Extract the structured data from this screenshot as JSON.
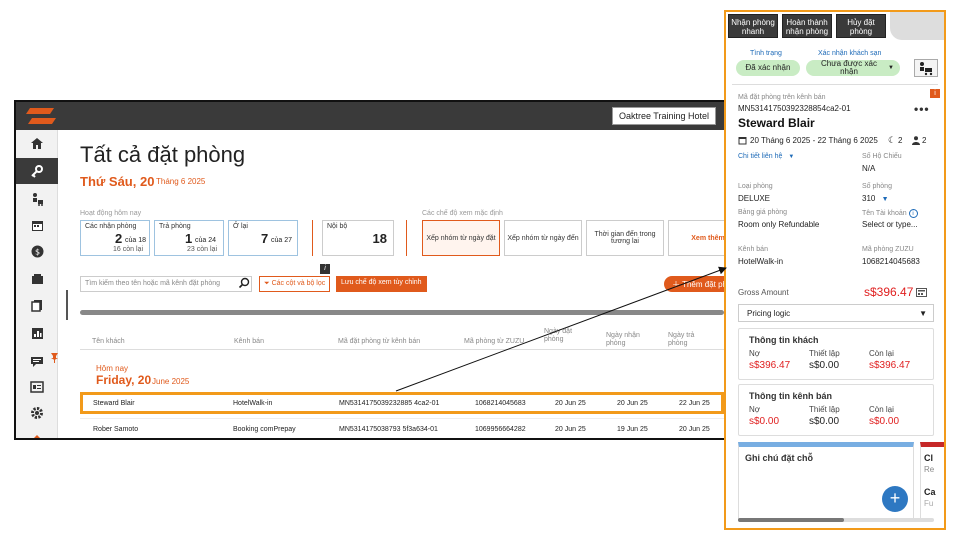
{
  "topbar": {
    "hotel_name": "Oaktree Training Hotel"
  },
  "page": {
    "title": "Tất cả đặt phòng",
    "day": "Thứ Sáu, 20",
    "month": "Tháng 6 2025"
  },
  "activity": {
    "label": "Hoạt động hôm nay",
    "cards": [
      {
        "label": "Các nhận phòng",
        "value": "2",
        "of": "của 18",
        "sub": "16 còn lại"
      },
      {
        "label": "Trả phòng",
        "value": "1",
        "of": "của 24",
        "sub": "23 còn lại"
      },
      {
        "label": "Ở lại",
        "value": "7",
        "of": "của 27",
        "sub": ""
      },
      {
        "label": "Nội bộ",
        "value": "18",
        "of": "",
        "sub": ""
      }
    ]
  },
  "views": {
    "label": "Các chế độ xem mặc định",
    "items": [
      "Xếp nhóm từ ngày đặt",
      "Xếp nhóm từ ngày đến",
      "Thời gian đến trong tương lai",
      "Xem thêm"
    ]
  },
  "toolbar": {
    "search_placeholder": "Tìm kiếm theo tên hoặc mã kênh đặt phòng",
    "filter_label": "Các cột và bộ lọc",
    "save_view_label": "Lưu chế độ xem tùy chỉnh",
    "info_glyph": "i",
    "add_label": "Thêm đặt phòng"
  },
  "table": {
    "headers": [
      "Tên khách",
      "Kênh bán",
      "Mã đặt phòng từ kênh bán",
      "Mã phòng từ ZUZU",
      "Ngày đặt phòng",
      "Ngày nhận phòng",
      "Ngày trả phòng"
    ],
    "group_label": "Hôm nay",
    "group_date": "Friday, 20",
    "group_month": "June 2025",
    "rows": [
      {
        "guest": "Steward Blair",
        "channel": "HotelWalk-in",
        "ota_id": "MN5314175039232885 4ca2-01",
        "zuzu_id": "1068214045683",
        "booked": "20 Jun 25",
        "checkin": "20 Jun 25",
        "checkout": "22 Jun 25"
      },
      {
        "guest": "Rober Samoto",
        "channel": "Booking comPrepay",
        "ota_id": "MN5314175038793 5f3a634-01",
        "zuzu_id": "1069956664282",
        "booked": "20 Jun 25",
        "checkin": "19 Jun 25",
        "checkout": "20 Jun 25"
      }
    ]
  },
  "panel": {
    "top_buttons": [
      "Nhận phòng nhanh",
      "Hoàn thành nhận phòng",
      "Hủy đặt phòng"
    ],
    "status_label": "Tình trạng",
    "status_value": "Đã xác nhận",
    "hotel_confirm_label": "Xác nhận khách sạn",
    "hotel_confirm_value": "Chưa được xác nhận",
    "ota_label": "Mã đặt phòng trên kênh bán",
    "ota_value": "MN53141750392328854ca2-01",
    "ota_badge": "i",
    "guest_name": "Steward Blair",
    "stay_dates": "20 Tháng 6 2025 - 22 Tháng 6 2025",
    "nights": "2",
    "guests": "2",
    "contact_label": "Chi tiết liên hệ",
    "passport_label": "Số Hộ Chiếu",
    "passport_value": "N/A",
    "room_type_label": "Loại phòng",
    "room_type_value": "DELUXE",
    "room_no_label": "Số phòng",
    "room_no_value": "310",
    "rate_label": "Bảng giá phòng",
    "rate_value": "Room only Refundable",
    "account_label": "Tên Tài khoản",
    "account_value": "Select or type...",
    "channel_label": "Kênh bán",
    "channel_value": "HotelWalk-in",
    "zuzu_label": "Mã phòng ZUZU",
    "zuzu_value": "1068214045683",
    "gross_label": "Gross Amount",
    "gross_value": "s$396.47",
    "pricing_label": "Pricing logic",
    "guest_box": {
      "title": "Thông tin khách",
      "cols": [
        "Nợ",
        "Thiết lập",
        "Còn lại"
      ],
      "vals": [
        "s$396.47",
        "s$0.00",
        "s$396.47"
      ]
    },
    "channel_box": {
      "title": "Thông tin kênh bán",
      "cols": [
        "Nợ",
        "Thiết lập",
        "Còn lại"
      ],
      "vals": [
        "s$0.00",
        "s$0.00",
        "s$0.00"
      ]
    },
    "notes_title": "Ghi chú đặt chỗ",
    "notes_add": "+",
    "card2_lines": [
      "Cl",
      "Re",
      "Ca",
      "Fu"
    ]
  },
  "colors": {
    "accent": "#e05a1c",
    "highlight": "#f29a1a",
    "link": "#1e6bb8",
    "status_bg": "#c9ecc4",
    "negative": "#e02020"
  }
}
